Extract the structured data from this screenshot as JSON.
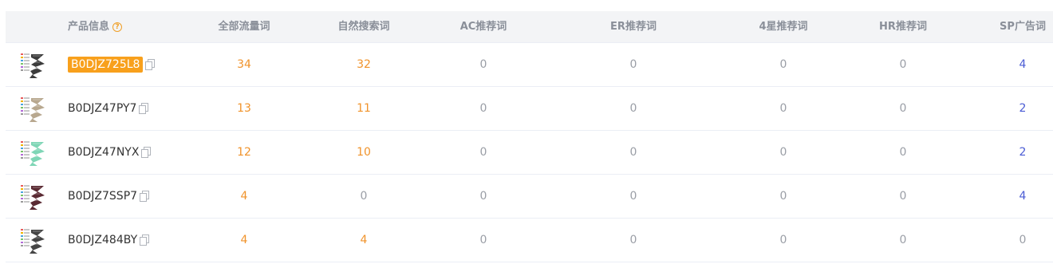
{
  "headers": {
    "product": "产品信息",
    "all_traffic": "全部流量词",
    "organic": "自然搜索词",
    "ac": "AC推荐词",
    "er": "ER推荐词",
    "four_star": "4星推荐词",
    "hr": "HR推荐词",
    "sp": "SP广告词"
  },
  "rows": [
    {
      "asin": "B0DJZ725L8",
      "highlighted": true,
      "all_traffic": "34",
      "organic": "32",
      "ac": "0",
      "er": "0",
      "four_star": "0",
      "hr": "0",
      "sp": "4",
      "thumb_color": "#3c3c3c"
    },
    {
      "asin": "B0DJZ47PY7",
      "highlighted": false,
      "all_traffic": "13",
      "organic": "11",
      "ac": "0",
      "er": "0",
      "four_star": "0",
      "hr": "0",
      "sp": "2",
      "thumb_color": "#b8a88f"
    },
    {
      "asin": "B0DJZ47NYX",
      "highlighted": false,
      "all_traffic": "12",
      "organic": "10",
      "ac": "0",
      "er": "0",
      "four_star": "0",
      "hr": "0",
      "sp": "2",
      "thumb_color": "#7fd6b6"
    },
    {
      "asin": "B0DJZ7SSP7",
      "highlighted": false,
      "all_traffic": "4",
      "organic": "0",
      "ac": "0",
      "er": "0",
      "four_star": "0",
      "hr": "0",
      "sp": "4",
      "thumb_color": "#5a2a33"
    },
    {
      "asin": "B0DJZ484BY",
      "highlighted": false,
      "all_traffic": "4",
      "organic": "4",
      "ac": "0",
      "er": "0",
      "four_star": "0",
      "hr": "0",
      "sp": "0",
      "thumb_color": "#454545"
    }
  ],
  "colors": {
    "highlight": "#f8a01c",
    "orange_value": "#f0932b",
    "gray_value": "#9a9ea6",
    "blue_value": "#4a5bd4",
    "header_bg": "#f3f4f6"
  },
  "icons": {
    "help": "question-circle-icon",
    "copy": "copy-icon",
    "thumbnail": "product-thumbnail"
  }
}
